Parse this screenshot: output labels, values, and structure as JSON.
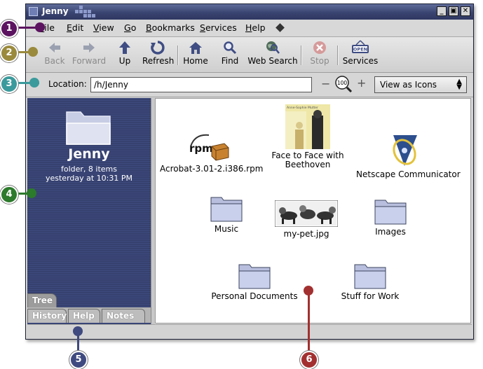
{
  "window": {
    "title": "Jenny"
  },
  "menubar": {
    "items": [
      {
        "label": "File",
        "mnemonic": "F"
      },
      {
        "label": "Edit",
        "mnemonic": "E"
      },
      {
        "label": "View",
        "mnemonic": "V"
      },
      {
        "label": "Go",
        "mnemonic": "G"
      },
      {
        "label": "Bookmarks",
        "mnemonic": "B"
      },
      {
        "label": "Services",
        "mnemonic": "S"
      },
      {
        "label": "Help",
        "mnemonic": "H"
      }
    ]
  },
  "toolbar": {
    "back": "Back",
    "forward": "Forward",
    "up": "Up",
    "refresh": "Refresh",
    "home": "Home",
    "find": "Find",
    "web_search": "Web Search",
    "stop": "Stop",
    "services": "Services",
    "services_sign": "OPEN"
  },
  "location": {
    "label": "Location:",
    "value": "/h/Jenny",
    "zoom": "100",
    "view_mode": "View as Icons"
  },
  "sidebar": {
    "title": "Jenny",
    "info": "folder, 8 items",
    "modified": "yesterday at 10:31 PM",
    "tabs": {
      "tree": "Tree",
      "history": "History",
      "help": "Help",
      "notes": "Notes"
    }
  },
  "icons": {
    "rpm_file": "Acrobat-3.01-2.i386.rpm",
    "rpm_badge": "rpm",
    "album": "Face to Face with Beethoven",
    "album_cover_text": "Anne-Sophie Mutter",
    "netscape": "Netscape Communicator",
    "music": "Music",
    "pet": "my-pet.jpg",
    "images": "Images",
    "personal_docs": "Personal Documents",
    "stuff_for_work": "Stuff for Work"
  },
  "callouts": [
    "1",
    "2",
    "3",
    "4",
    "5",
    "6"
  ],
  "colors": {
    "callout_1": "#5c1460",
    "callout_2": "#9a8a3c",
    "callout_3": "#3b9a9c",
    "callout_4": "#2c7a2c",
    "callout_5": "#3f4a80",
    "callout_6": "#a33030",
    "sidebar_bg": "#3e4a7e",
    "titlebar": "#3a4470"
  }
}
